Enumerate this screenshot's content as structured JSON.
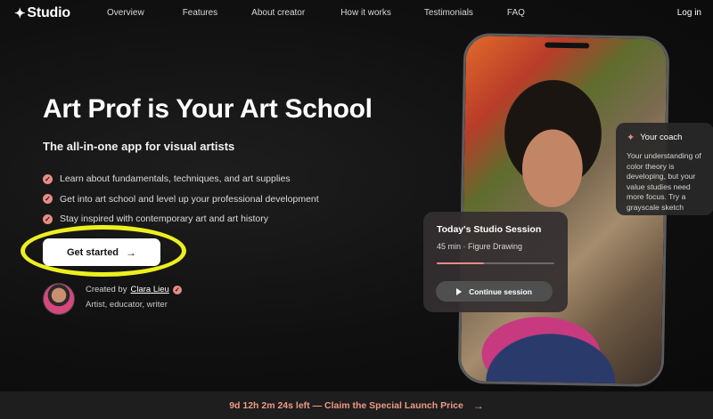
{
  "nav": {
    "logo": "Studio",
    "links": [
      "Overview",
      "Features",
      "About creator",
      "How it works",
      "Testimonials",
      "FAQ"
    ],
    "login": "Log in"
  },
  "hero": {
    "title": "Art Prof is Your Art School",
    "subtitle": "The all-in-one app for visual artists",
    "features": [
      "Learn about fundamentals, techniques, and art supplies",
      "Get into art school and level up your professional development",
      "Stay inspired with contemporary art and art history"
    ],
    "cta_label": "Get started",
    "cta_highlighted": true
  },
  "creator": {
    "created_by": "Created by",
    "name": "Clara Lieu",
    "role": "Artist, educator, writer"
  },
  "coach": {
    "title": "Your coach",
    "message": "Your understanding of color theory is developing, but your value studies need more focus. Try a grayscale sketch exercise to strengthen your tonal..."
  },
  "session": {
    "title": "Today's Studio Session",
    "meta": "45 min · Figure Drawing",
    "progress_fraction": 0.4,
    "button_label": "Continue session"
  },
  "banner": {
    "text": "9d 12h 2m 24s left — Claim the Special Launch Price"
  },
  "colors": {
    "accent": "#e98b87",
    "highlight_ring": "#eef01e",
    "banner_text": "#ee9a86",
    "background": "#0c0c0c"
  },
  "icons": [
    "star-icon",
    "check-icon",
    "arrow-right-icon",
    "verified-icon",
    "sparkle-icon",
    "play-icon"
  ]
}
